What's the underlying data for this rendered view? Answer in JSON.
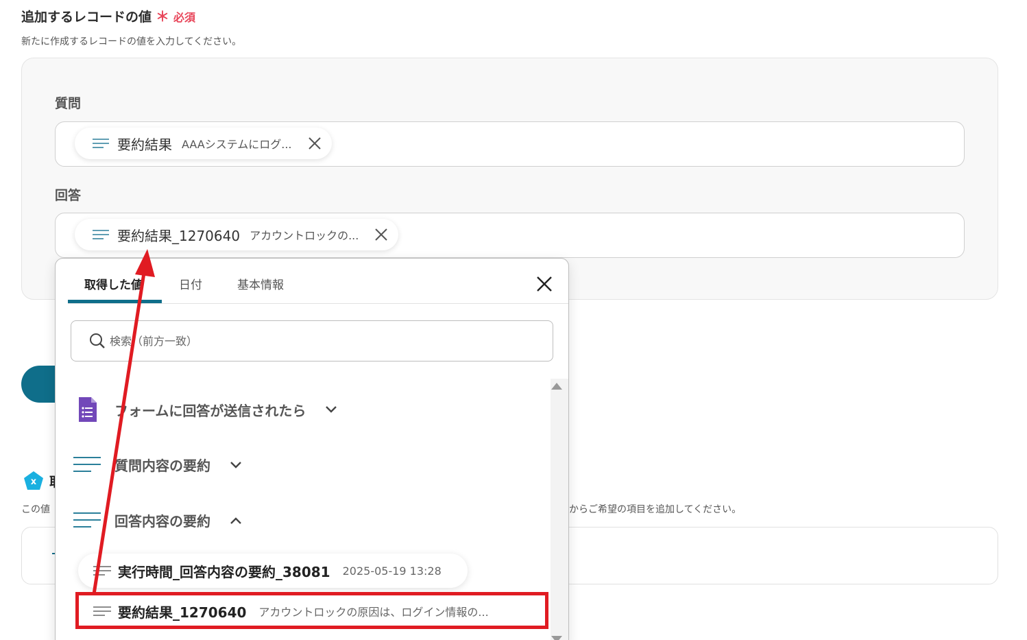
{
  "section": {
    "title": "追加するレコードの値",
    "required_mark": "＊",
    "required_label": "必須",
    "description": "新たに作成するレコードの値を入力してください。"
  },
  "fields": [
    {
      "label": "質問",
      "chip_name": "要約結果",
      "chip_value": "AAAシステムにログ..."
    },
    {
      "label": "回答",
      "chip_name": "要約結果_1270640",
      "chip_value": "アカウントロックの..."
    }
  ],
  "background": {
    "title_fragment": "取",
    "desc_fragment_left": "この値",
    "desc_fragment_right": "からご希望の項目を追加してください。"
  },
  "popup": {
    "tabs": [
      "取得した値",
      "日付",
      "基本情報"
    ],
    "active_tab": "取得した値",
    "search_placeholder": "検索（前方一致）",
    "groups": [
      {
        "label": "フォームに回答が送信されたら",
        "icon": "google-forms-icon",
        "state": "collapsed"
      },
      {
        "label": "質問内容の要約",
        "icon": "text-lines-icon",
        "state": "collapsed"
      },
      {
        "label": "回答内容の要約",
        "icon": "text-lines-icon",
        "state": "expanded"
      }
    ],
    "items": [
      {
        "name": "実行時間_回答内容の要約_38081",
        "value": "2025-05-19 13:28"
      },
      {
        "name": "要約結果_1270640",
        "value": "アカウントロックの原因は、ログイン情報の..."
      }
    ]
  },
  "colors": {
    "accent": "#0f6e8a",
    "required": "#e8465a",
    "annotation_red": "#e01b22",
    "forms_purple": "#7248b9"
  }
}
